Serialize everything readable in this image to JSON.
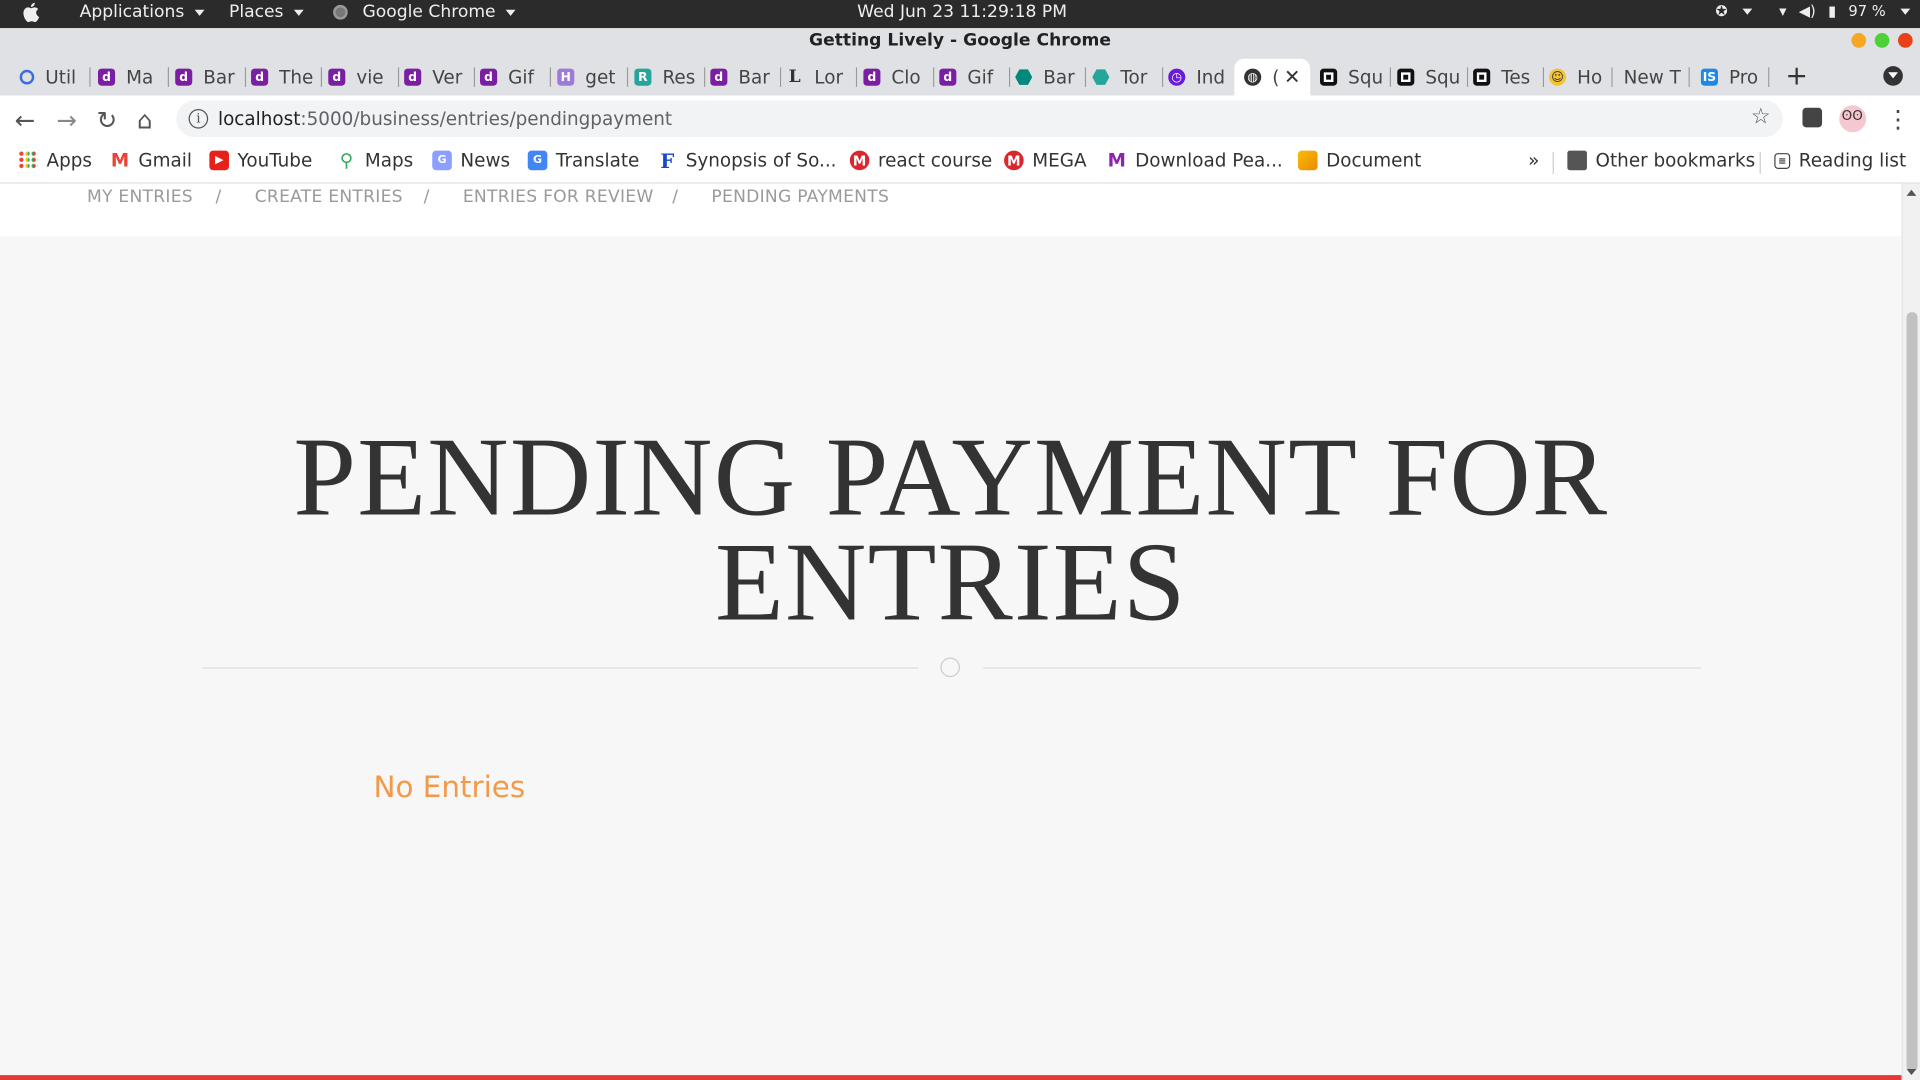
{
  "system_bar": {
    "applications": "Applications",
    "places": "Places",
    "app_menu": "Google Chrome",
    "clock": "Wed Jun 23  11:29:18 PM",
    "battery": "97 %"
  },
  "window": {
    "title": "Getting Lively - Google Chrome"
  },
  "tabs": [
    {
      "label": "Util",
      "icon": "loading-spinner-icon"
    },
    {
      "label": "Ma",
      "icon": "d-logo-icon"
    },
    {
      "label": "Bar",
      "icon": "d-logo-icon"
    },
    {
      "label": "The",
      "icon": "d-logo-icon"
    },
    {
      "label": "vie",
      "icon": "d-logo-icon"
    },
    {
      "label": "Ver",
      "icon": "d-logo-icon"
    },
    {
      "label": "Gif",
      "icon": "d-logo-icon"
    },
    {
      "label": "get",
      "icon": "h-logo-icon"
    },
    {
      "label": "Res",
      "icon": "r-logo-icon"
    },
    {
      "label": "Bar",
      "icon": "d-logo-icon"
    },
    {
      "label": "Lor",
      "icon": "l-logo-icon"
    },
    {
      "label": "Clo",
      "icon": "d-logo-icon"
    },
    {
      "label": "Gif",
      "icon": "d-logo-icon"
    },
    {
      "label": "Bar",
      "icon": "hexagon-icon"
    },
    {
      "label": "Tor",
      "icon": "hexagon-icon"
    },
    {
      "label": "Ind",
      "icon": "timer-icon"
    },
    {
      "label": "(",
      "icon": "globe-icon"
    },
    {
      "label": "Squ",
      "icon": "square-logo-icon"
    },
    {
      "label": "Squ",
      "icon": "square-logo-icon"
    },
    {
      "label": "Tes",
      "icon": "square-logo-icon"
    },
    {
      "label": "Ho",
      "icon": "emoji-icon"
    },
    {
      "label": "New T",
      "icon": ""
    },
    {
      "label": "Pro",
      "icon": "is-logo-icon"
    }
  ],
  "address_bar": {
    "host": "localhost",
    "path": ":5000/business/entries/pendingpayment"
  },
  "bookmarks": [
    {
      "label": "Apps",
      "icon": "apps-grid-icon"
    },
    {
      "label": "Gmail",
      "icon": "gmail-icon"
    },
    {
      "label": "YouTube",
      "icon": "youtube-icon"
    },
    {
      "label": "Maps",
      "icon": "maps-pin-icon"
    },
    {
      "label": "News",
      "icon": "news-icon"
    },
    {
      "label": "Translate",
      "icon": "translate-icon"
    },
    {
      "label": "Synopsis of So...",
      "icon": "f-logo-icon"
    },
    {
      "label": "react course",
      "icon": "mega-icon"
    },
    {
      "label": "MEGA",
      "icon": "mega-icon"
    },
    {
      "label": "Download Pea...",
      "icon": "m-logo-icon"
    },
    {
      "label": "Document",
      "icon": "document-icon"
    }
  ],
  "bookmarks_overflow": "»",
  "other_bookmarks": "Other bookmarks",
  "reading_list": "Reading list",
  "subnav": {
    "items": [
      "MY ENTRIES",
      "CREATE ENTRIES",
      "ENTRIES FOR REVIEW",
      "PENDING PAYMENTS"
    ],
    "separator": "/"
  },
  "main": {
    "heading_line1": "PENDING PAYMENT FOR",
    "heading_line2": "ENTRIES",
    "empty_message": "No Entries"
  },
  "colors": {
    "heading": "#333333",
    "empty_message": "#f29a4a",
    "accent_line": "#e53935"
  }
}
